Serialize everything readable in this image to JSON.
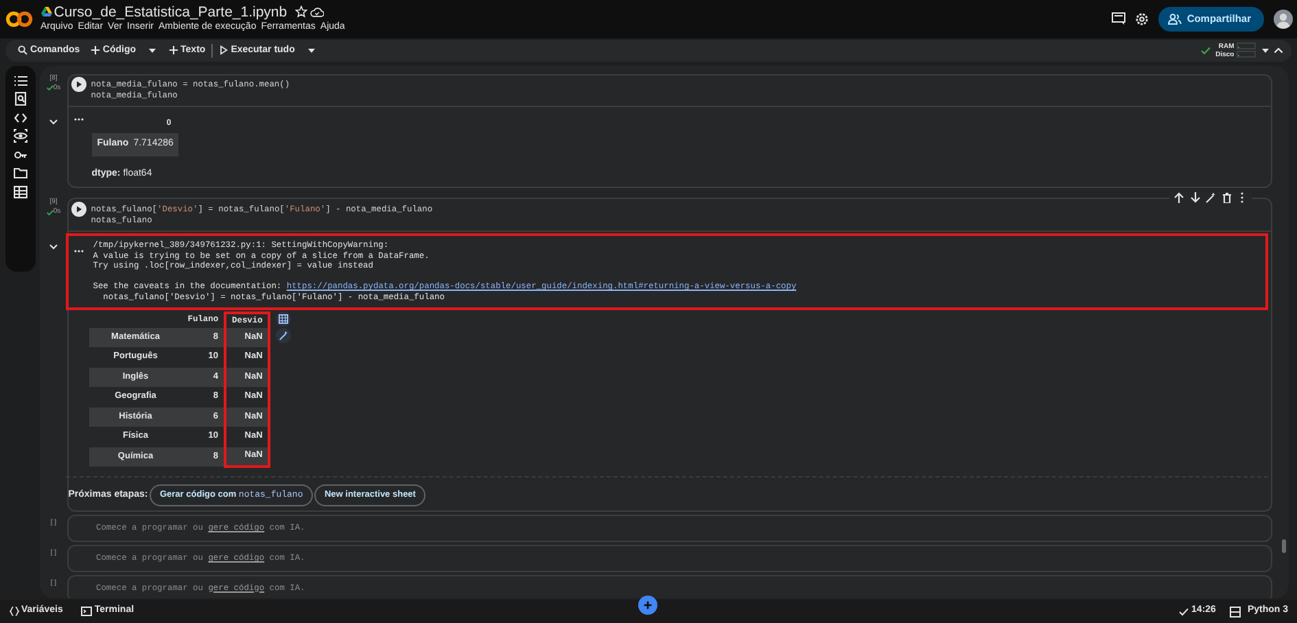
{
  "header": {
    "title": "Curso_de_Estatistica_Parte_1.ipynb",
    "menu": [
      "Arquivo",
      "Editar",
      "Ver",
      "Inserir",
      "Ambiente de execução",
      "Ferramentas",
      "Ajuda"
    ],
    "share_button": "Compartilhar"
  },
  "toolbar": {
    "search": "Comandos",
    "buttons": [
      {
        "kind": "add",
        "label": "Código",
        "caret": true
      },
      {
        "kind": "add",
        "label": "Texto",
        "caret": false
      },
      {
        "kind": "run",
        "label": "Executar tudo",
        "caret": true
      }
    ],
    "resources": [
      {
        "label": "RAM",
        "level": 0.1
      },
      {
        "label": "Disco",
        "level": 0.1
      }
    ]
  },
  "cells": [
    {
      "kind": "code",
      "exec_count": "[8]",
      "run_time": "0s",
      "toolbar": false,
      "code": [
        "nota_media_fulano = notas_fulano.mean()",
        "nota_media_fulano"
      ],
      "output": {
        "kind": "series",
        "header": "0",
        "rows": [
          {
            "index": "Fulano",
            "value": "7.714286"
          }
        ],
        "dtype_label": "dtype:",
        "dtype": "float64"
      }
    },
    {
      "kind": "code",
      "exec_count": "[9]",
      "run_time": "0s",
      "toolbar": true,
      "code": [
        "notas_fulano['Desvio'] = notas_fulano['Fulano'] - nota_media_fulano",
        "notas_fulano"
      ],
      "output": {
        "kind": "dataframe",
        "warning": {
          "annotated": true,
          "lines": [
            "/tmp/ipykernel_389/349761232.py:1: SettingWithCopyWarning:",
            "A value is trying to be set on a copy of a slice from a DataFrame.",
            "Try using .loc[row_indexer,col_indexer] = value instead"
          ],
          "doc_text": "See the caveats in the documentation: ",
          "doc_link": "https://pandas.pydata.org/pandas-docs/stable/user_guide/indexing.html#returning-a-view-versus-a-copy",
          "source_line": "  notas_fulano['Desvio'] = notas_fulano['Fulano'] - nota_media_fulano"
        },
        "columns": [
          {
            "label": "Fulano",
            "annotated": false
          },
          {
            "label": "Desvio",
            "annotated": true
          }
        ],
        "rows": [
          {
            "index": "Matemática",
            "values": [
              "8",
              "NaN"
            ]
          },
          {
            "index": "Português",
            "values": [
              "10",
              "NaN"
            ]
          },
          {
            "index": "Inglês",
            "values": [
              "4",
              "NaN"
            ]
          },
          {
            "index": "Geografia",
            "values": [
              "8",
              "NaN"
            ]
          },
          {
            "index": "História",
            "values": [
              "6",
              "NaN"
            ]
          },
          {
            "index": "Física",
            "values": [
              "10",
              "NaN"
            ]
          },
          {
            "index": "Química",
            "values": [
              "8",
              "NaN"
            ]
          }
        ],
        "next_steps": {
          "label": "Próximas etapas:",
          "buttons": [
            {
              "text": "Gerar código com ",
              "code": "notas_fulano"
            },
            {
              "text": "New interactive sheet"
            }
          ]
        }
      }
    },
    {
      "kind": "empty",
      "exec_count": "[ ]",
      "hint": "Comece a programar ou ",
      "hint_link": "gere código",
      "hint_end": " com IA."
    },
    {
      "kind": "empty",
      "exec_count": "[ ]",
      "hint": "Comece a programar ou ",
      "hint_link": "gere código",
      "hint_end": " com IA."
    },
    {
      "kind": "empty",
      "exec_count": "[ ]",
      "hint": "Comece a programar ou ",
      "hint_link": "gere código",
      "hint_end": " com IA."
    }
  ],
  "status_bar": {
    "left": [
      "Variáveis",
      "Terminal"
    ],
    "time": "14:26",
    "runtime": "Python 3"
  }
}
